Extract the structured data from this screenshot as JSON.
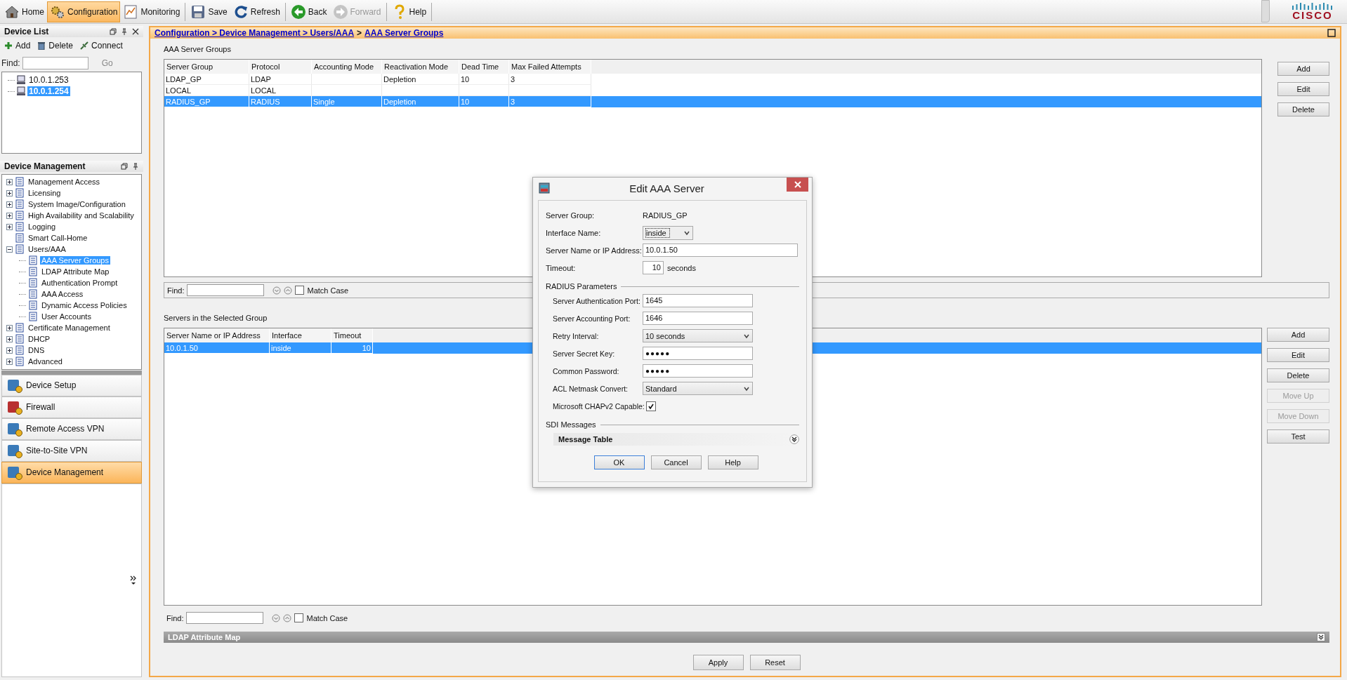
{
  "toolbar": {
    "groups": [
      [
        {
          "label": "Home",
          "selected": false,
          "disabled": false
        },
        {
          "label": "Configuration",
          "selected": true,
          "disabled": false
        },
        {
          "label": "Monitoring",
          "selected": false,
          "disabled": false
        }
      ],
      [
        {
          "label": "Save",
          "selected": false,
          "disabled": false
        },
        {
          "label": "Refresh",
          "selected": false,
          "disabled": false
        }
      ],
      [
        {
          "label": "Back",
          "selected": false,
          "disabled": false
        },
        {
          "label": "Forward",
          "selected": false,
          "disabled": true
        }
      ],
      [
        {
          "label": "Help",
          "selected": false,
          "disabled": false
        }
      ]
    ],
    "logo": "CISCO"
  },
  "device_list": {
    "title": "Device List",
    "actions": [
      "Add",
      "Delete",
      "Connect"
    ],
    "find_label": "Find:",
    "go": "Go",
    "devices": [
      {
        "label": "10.0.1.253",
        "selected": false
      },
      {
        "label": "10.0.1.254",
        "selected": true
      }
    ]
  },
  "device_management": {
    "title": "Device Management",
    "tree": [
      {
        "label": "Management Access",
        "kind": "folder",
        "expanded": false,
        "selected": false
      },
      {
        "label": "Licensing",
        "kind": "folder",
        "expanded": false,
        "selected": false
      },
      {
        "label": "System Image/Configuration",
        "kind": "folder",
        "expanded": false,
        "selected": false
      },
      {
        "label": "High Availability and Scalability",
        "kind": "folder",
        "expanded": false,
        "selected": false
      },
      {
        "label": "Logging",
        "kind": "folder",
        "expanded": false,
        "selected": false
      },
      {
        "label": "Smart Call-Home",
        "kind": "leaf",
        "selected": false
      },
      {
        "label": "Users/AAA",
        "kind": "folder",
        "expanded": true,
        "selected": false,
        "children": [
          {
            "label": "AAA Server Groups",
            "selected": true
          },
          {
            "label": "LDAP Attribute Map",
            "selected": false
          },
          {
            "label": "Authentication Prompt",
            "selected": false
          },
          {
            "label": "AAA Access",
            "selected": false
          },
          {
            "label": "Dynamic Access Policies",
            "selected": false
          },
          {
            "label": "User Accounts",
            "selected": false
          }
        ]
      },
      {
        "label": "Certificate Management",
        "kind": "folder",
        "expanded": false,
        "selected": false
      },
      {
        "label": "DHCP",
        "kind": "folder",
        "expanded": false,
        "selected": false
      },
      {
        "label": "DNS",
        "kind": "folder",
        "expanded": false,
        "selected": false
      },
      {
        "label": "Advanced",
        "kind": "folder",
        "expanded": false,
        "selected": false
      }
    ]
  },
  "nav": [
    {
      "label": "Device Setup",
      "selected": false
    },
    {
      "label": "Firewall",
      "selected": false
    },
    {
      "label": "Remote Access VPN",
      "selected": false
    },
    {
      "label": "Site-to-Site VPN",
      "selected": false
    },
    {
      "label": "Device Management",
      "selected": true
    }
  ],
  "breadcrumb": [
    {
      "text": "Configuration > Device Management > Users/AAA",
      "kind": "link"
    },
    {
      "text": ">",
      "kind": "text"
    },
    {
      "text": "AAA Server Groups",
      "kind": "link"
    }
  ],
  "groups": {
    "title": "AAA Server Groups",
    "columns": [
      "Server Group",
      "Protocol",
      "Accounting Mode",
      "Reactivation Mode",
      "Dead Time",
      "Max Failed Attempts"
    ],
    "rows": [
      {
        "cells": [
          "LDAP_GP",
          "LDAP",
          "",
          "Depletion",
          "10",
          "3"
        ],
        "selected": false
      },
      {
        "cells": [
          "LOCAL",
          "LOCAL",
          "",
          "",
          "",
          ""
        ],
        "selected": false
      },
      {
        "cells": [
          "RADIUS_GP",
          "RADIUS",
          "Single",
          "Depletion",
          "10",
          "3"
        ],
        "selected": true
      }
    ],
    "buttons": [
      {
        "label": "Add",
        "disabled": false
      },
      {
        "label": "Edit",
        "disabled": false
      },
      {
        "label": "Delete",
        "disabled": false
      }
    ],
    "find": {
      "label": "Find:",
      "match_case": "Match Case",
      "checked": false
    }
  },
  "servers": {
    "title": "Servers in the Selected Group",
    "columns": [
      "Server Name or IP Address",
      "Interface",
      "Timeout"
    ],
    "rows": [
      {
        "cells": [
          "10.0.1.50",
          "inside",
          "10"
        ],
        "selected": true
      }
    ],
    "buttons": [
      {
        "label": "Add",
        "disabled": false
      },
      {
        "label": "Edit",
        "disabled": false
      },
      {
        "label": "Delete",
        "disabled": false
      },
      {
        "label": "Move Up",
        "disabled": true
      },
      {
        "label": "Move Down",
        "disabled": true
      },
      {
        "label": "Test",
        "disabled": false
      }
    ],
    "find": {
      "label": "Find:",
      "match_case": "Match Case",
      "checked": false
    }
  },
  "ldap_bar": {
    "title": "LDAP Attribute Map",
    "expanded": false
  },
  "footer_buttons": [
    "Apply",
    "Reset"
  ],
  "dialog": {
    "title": "Edit AAA Server",
    "fields": [
      {
        "kind": "static",
        "label": "Server Group:",
        "value": "RADIUS_GP"
      },
      {
        "kind": "select",
        "label": "Interface Name:",
        "value": "inside"
      },
      {
        "kind": "text",
        "label": "Server Name or IP Address:",
        "value": "10.0.1.50"
      },
      {
        "kind": "number",
        "label": "Timeout:",
        "value": "10",
        "unit": "seconds"
      }
    ],
    "sections": [
      {
        "title": "RADIUS Parameters",
        "fields": [
          {
            "kind": "text",
            "label": "Server Authentication Port:",
            "value": "1645"
          },
          {
            "kind": "text",
            "label": "Server Accounting Port:",
            "value": "1646"
          },
          {
            "kind": "wideselect",
            "label": "Retry Interval:",
            "value": "10 seconds"
          },
          {
            "kind": "password",
            "label": "Server Secret Key:",
            "value": "●●●●●"
          },
          {
            "kind": "password",
            "label": "Common Password:",
            "value": "●●●●●"
          },
          {
            "kind": "wideselect",
            "label": "ACL Netmask Convert:",
            "value": "Standard"
          },
          {
            "kind": "checkbox",
            "label": "Microsoft CHAPv2 Capable:",
            "checked": true
          }
        ]
      },
      {
        "title": "SDI Messages",
        "panels": [
          {
            "title": "Message Table",
            "expanded": false
          }
        ]
      }
    ],
    "buttons": [
      {
        "label": "OK",
        "default": true
      },
      {
        "label": "Cancel",
        "default": false
      },
      {
        "label": "Help",
        "default": false
      }
    ]
  }
}
